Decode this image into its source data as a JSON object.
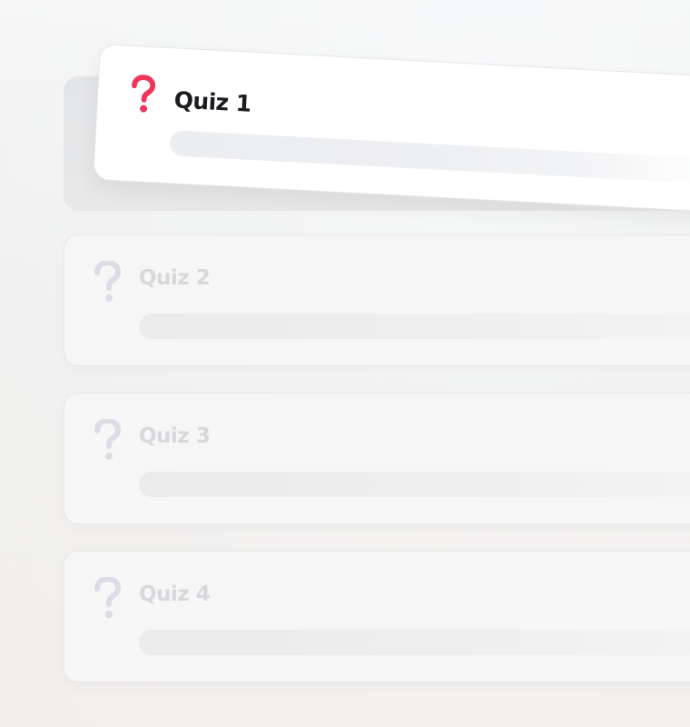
{
  "quizzes": [
    {
      "title": "Quiz 1",
      "active": true
    },
    {
      "title": "Quiz 2",
      "active": false
    },
    {
      "title": "Quiz 3",
      "active": false
    },
    {
      "title": "Quiz 4",
      "active": false
    }
  ],
  "icons": {
    "question_icon": "question-mark-icon"
  },
  "colors": {
    "accent": "#f0355c",
    "inactive_icon": "#dedbe6",
    "active_title": "#1c1b20",
    "inactive_title": "#d8d7dc"
  }
}
